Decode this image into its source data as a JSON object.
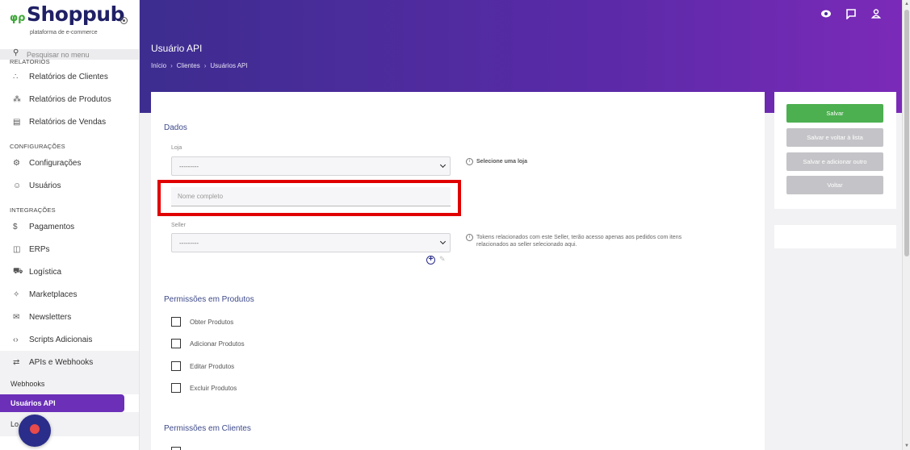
{
  "brand": {
    "name": "Shoppub",
    "tagline": "plataforma de e-commerce",
    "mark": "φρ"
  },
  "search": {
    "placeholder": "Pesquisar no menu"
  },
  "sidebar": {
    "sections": [
      {
        "header": "RELATÓRIOS",
        "items": [
          {
            "icon": "∴",
            "label": "Relatórios de Clientes"
          },
          {
            "icon": "⁂",
            "label": "Relatórios de Produtos"
          },
          {
            "icon": "▤",
            "label": "Relatórios de Vendas"
          }
        ]
      },
      {
        "header": "CONFIGURAÇÕES",
        "items": [
          {
            "icon": "⚙",
            "label": "Configurações"
          },
          {
            "icon": "☺",
            "label": "Usuários"
          }
        ]
      },
      {
        "header": "INTEGRAÇÕES",
        "items": [
          {
            "icon": "$",
            "label": "Pagamentos"
          },
          {
            "icon": "◫",
            "label": "ERPs"
          },
          {
            "icon": "⛟",
            "label": "Logística"
          },
          {
            "icon": "✧",
            "label": "Marketplaces"
          },
          {
            "icon": "✉",
            "label": "Newsletters"
          },
          {
            "icon": "‹›",
            "label": "Scripts Adicionais"
          },
          {
            "icon": "⇄",
            "label": "APIs e Webhooks"
          }
        ]
      }
    ],
    "subitems": [
      {
        "label": "Webhooks"
      },
      {
        "label": "Usuários API"
      },
      {
        "label": "Lo"
      }
    ]
  },
  "header": {
    "title": "Usuário API",
    "breadcrumb": [
      "Início",
      "Clientes",
      "Usuários API"
    ],
    "breadcrumb_sep": "›",
    "icons": [
      "eye-icon",
      "chat-icon",
      "user-icon"
    ]
  },
  "form": {
    "section_dados": "Dados",
    "loja_label": "Loja",
    "loja_value": "---------",
    "loja_hint": "Selecione uma loja",
    "nome_placeholder": "Nome completo",
    "seller_label": "Seller",
    "seller_value": "---------",
    "seller_hint": "Tokens relacionados com este Seller, terão acesso apenas aos pedidos com itens relacionados ao seller selecionado aqui.",
    "section_produtos": "Permissões em Produtos",
    "produtos_perms": [
      "Obter Produtos",
      "Adicionar Produtos",
      "Editar Produtos",
      "Excluir Produtos"
    ],
    "section_clientes": "Permissões em Clientes"
  },
  "actions": {
    "save": "Salvar",
    "save_back": "Salvar e voltar à lista",
    "save_add": "Salvar e adicionar outro",
    "back": "Voltar"
  },
  "colors": {
    "brand_green": "#3fa83a",
    "brand_navy": "#202066",
    "header_purple": "#5a2aa8",
    "save_green": "#4caf50",
    "highlight_red": "#e00000"
  }
}
